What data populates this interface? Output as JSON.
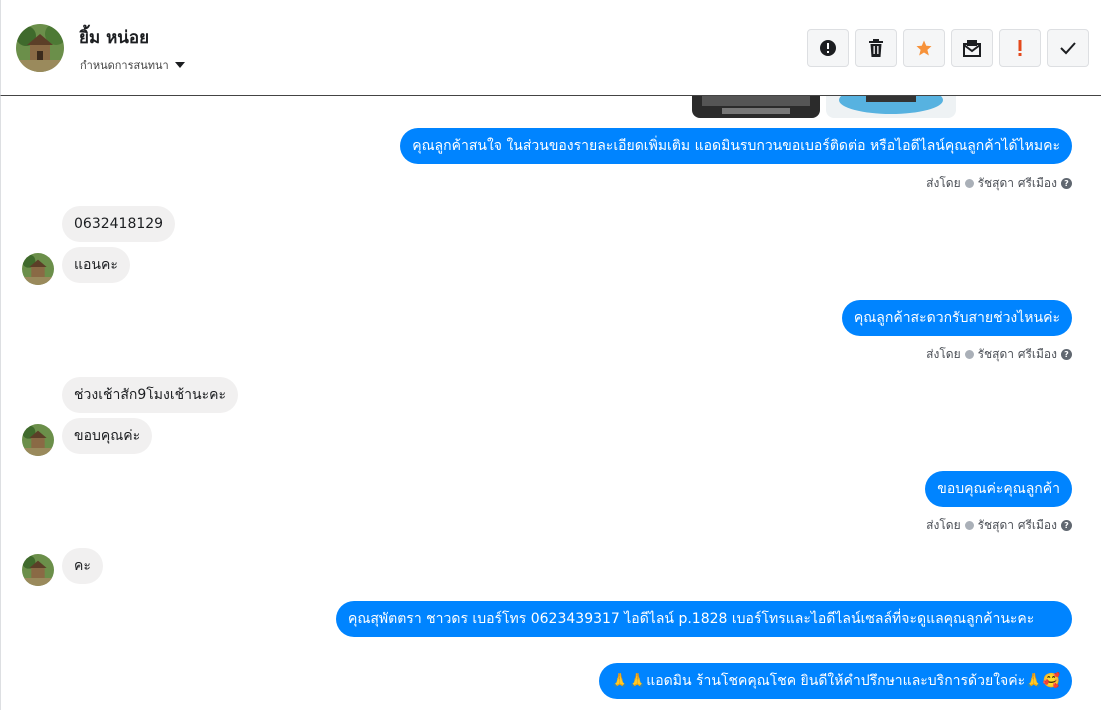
{
  "header": {
    "contact_name": "ยิ้ม หน่อย",
    "label_menu": "กำหนดการสนทนา"
  },
  "toolbar": {
    "buttons": [
      {
        "name": "spam",
        "icon": "exclamation-circle-icon"
      },
      {
        "name": "delete",
        "icon": "trash-icon"
      },
      {
        "name": "star",
        "icon": "star-icon"
      },
      {
        "name": "mark-unread",
        "icon": "envelope-icon"
      },
      {
        "name": "important",
        "icon": "exclamation-icon"
      },
      {
        "name": "done",
        "icon": "check-icon"
      }
    ]
  },
  "messages": [
    {
      "dir": "out",
      "text": "คุณลูกค้าสนใจ ในส่วนของรายละเอียดเพิ่มเติม แอดมินรบกวนขอเบอร์ติดต่อ หรือไอดีไลน์คุณลูกค้าได้ไหมคะ"
    },
    {
      "dir": "in",
      "text": "0632418129"
    },
    {
      "dir": "in",
      "text": "แอนคะ"
    },
    {
      "dir": "out",
      "text": "คุณลูกค้าสะดวกรับสายช่วงไหนค่ะ"
    },
    {
      "dir": "in",
      "text": "ช่วงเช้าสัก9โมงเช้านะคะ"
    },
    {
      "dir": "in",
      "text": "ขอบคุณค่ะ"
    },
    {
      "dir": "out",
      "text": "ขอบคุณค่ะคุณลูกค้า"
    },
    {
      "dir": "in",
      "text": "คะ"
    },
    {
      "dir": "out",
      "text": "คุณสุพัตตรา   ชาวดร      เบอร์โทร 0623439317  ไอดีไลน์ p.1828   เบอร์โทรและไอดีไลน์เซลล์ที่จะดูแลคุณลูกค้านะคะ"
    },
    {
      "dir": "out",
      "text": "🙏🙏แอดมิน ร้านโชคคุณโชค ยินดีให้คำปรึกษาและบริการด้วยใจค่ะ🙏🥰"
    }
  ],
  "sent_by": {
    "prefix": "ส่งโดย",
    "agent": "รัชสุดา ศรีเมือง"
  },
  "colors": {
    "outgoing_bubble": "#0084ff",
    "incoming_bubble": "#f1f0f0",
    "star": "#f7923a",
    "important": "#e4491c"
  }
}
